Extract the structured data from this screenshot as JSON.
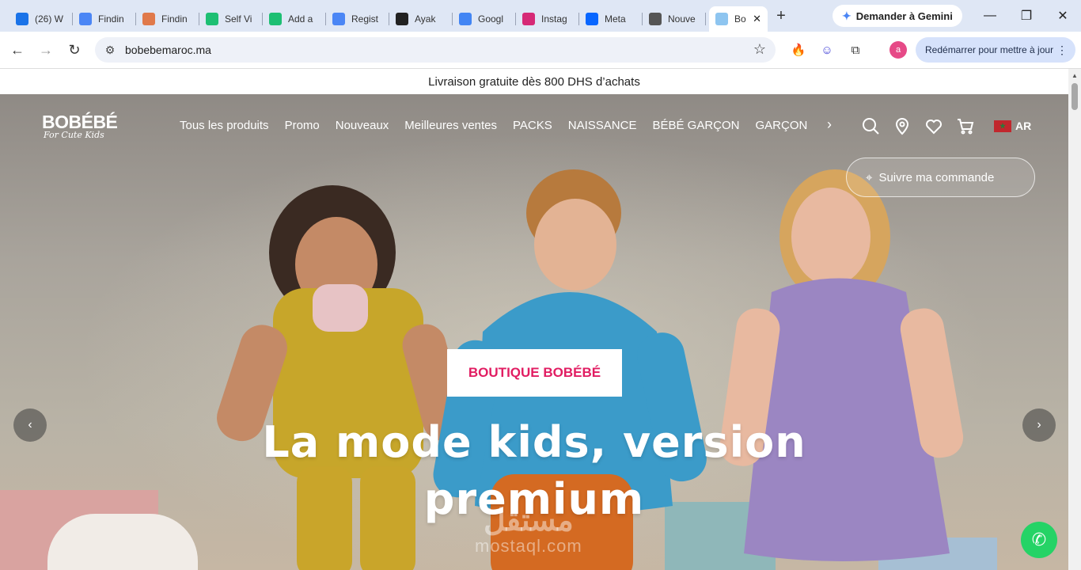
{
  "browser": {
    "tabs": [
      {
        "label": "(26) W",
        "icon": "mail-icon",
        "color": "#1a73e8"
      },
      {
        "label": "Findin",
        "icon": "gemini-icon",
        "color": "#4b86f5"
      },
      {
        "label": "Findin",
        "icon": "claude-icon",
        "color": "#e0794a"
      },
      {
        "label": "Self Vi",
        "icon": "fiverr-icon",
        "color": "#1dbf73"
      },
      {
        "label": "Add a",
        "icon": "fiverr-icon",
        "color": "#1dbf73"
      },
      {
        "label": "Regist",
        "icon": "gemini-icon",
        "color": "#4b86f5"
      },
      {
        "label": "Ayak",
        "icon": "ayak-icon",
        "color": "#222222"
      },
      {
        "label": "Googl",
        "icon": "translate-icon",
        "color": "#4285f4"
      },
      {
        "label": "Instag",
        "icon": "instagram-icon",
        "color": "#d62976"
      },
      {
        "label": "Meta",
        "icon": "meta-icon",
        "color": "#0866ff"
      },
      {
        "label": "Nouve",
        "icon": "chrome-icon",
        "color": "#555555"
      }
    ],
    "active_tab": {
      "label": "Bo",
      "icon": "bobebe-icon"
    },
    "gemini_button": "Demander à Gemini",
    "url": "bobebemaroc.ma",
    "profile_initial": "a",
    "restart_label": "Redémarrer pour mettre à jour"
  },
  "page": {
    "announcement": "Livraison gratuite dès 800 DHS d’achats",
    "logo": {
      "brand": "BOBÉBÉ",
      "tagline": "For Cute Kids"
    },
    "menu": [
      "Tous les produits",
      "Promo",
      "Nouveaux",
      "Meilleures ventes",
      "PACKS",
      "NAISSANCE",
      "BÉBÉ GARÇON",
      "GARÇON"
    ],
    "language": "AR",
    "track_order": "Suivre ma commande",
    "hero": {
      "cta": "BOUTIQUE BOBÉBÉ",
      "headline_line1": "La mode kids, version",
      "headline_line2": "premium"
    },
    "watermark": {
      "arabic": "مستقل",
      "latin": "mostaql.com"
    },
    "colors": {
      "accent": "#e11d62",
      "whatsapp": "#25d366"
    }
  }
}
